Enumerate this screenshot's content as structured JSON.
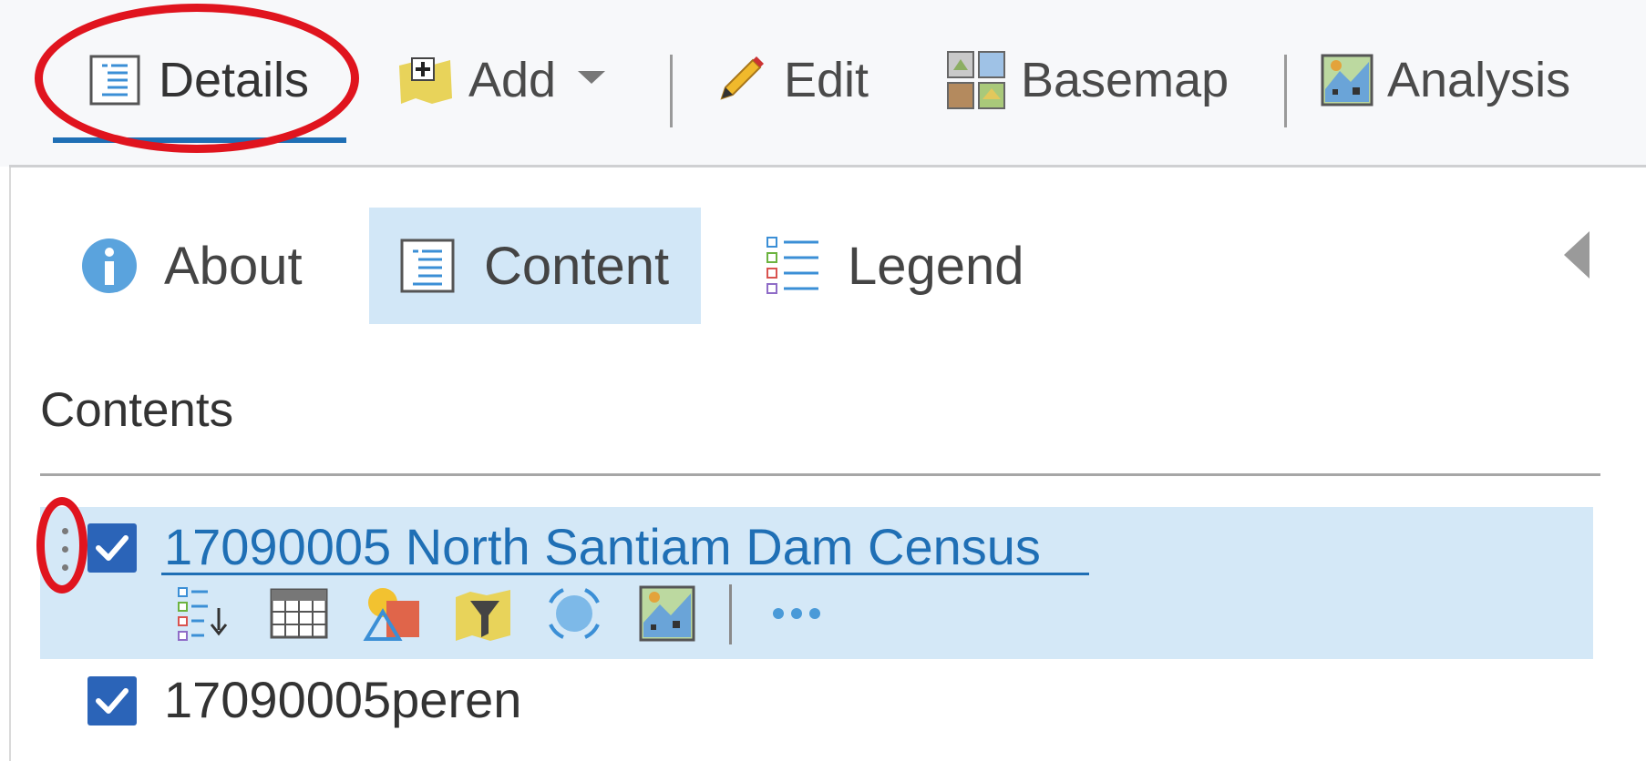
{
  "toolbar": {
    "details_label": "Details",
    "add_label": "Add",
    "edit_label": "Edit",
    "basemap_label": "Basemap",
    "analysis_label": "Analysis"
  },
  "tabs": {
    "about_label": "About",
    "content_label": "Content",
    "legend_label": "Legend",
    "active": "Content"
  },
  "contents": {
    "title": "Contents",
    "layers": [
      {
        "name": "17090005 North Santiam Dam Census",
        "checked": true,
        "selected": true
      },
      {
        "name": "17090005peren",
        "checked": true,
        "selected": false
      }
    ],
    "layer_actions": [
      "show-legend-icon",
      "table-icon",
      "change-style-icon",
      "filter-icon",
      "zoom-to-icon",
      "perform-analysis-icon",
      "more-options-icon"
    ]
  },
  "colors": {
    "accent_blue": "#1f6fb5",
    "selection_bg": "#d4e8f7",
    "checkbox_blue": "#2b64b8",
    "annotation_red": "#e0141e"
  },
  "annotations": [
    "Details tab circled",
    "layer drag handle circled"
  ]
}
